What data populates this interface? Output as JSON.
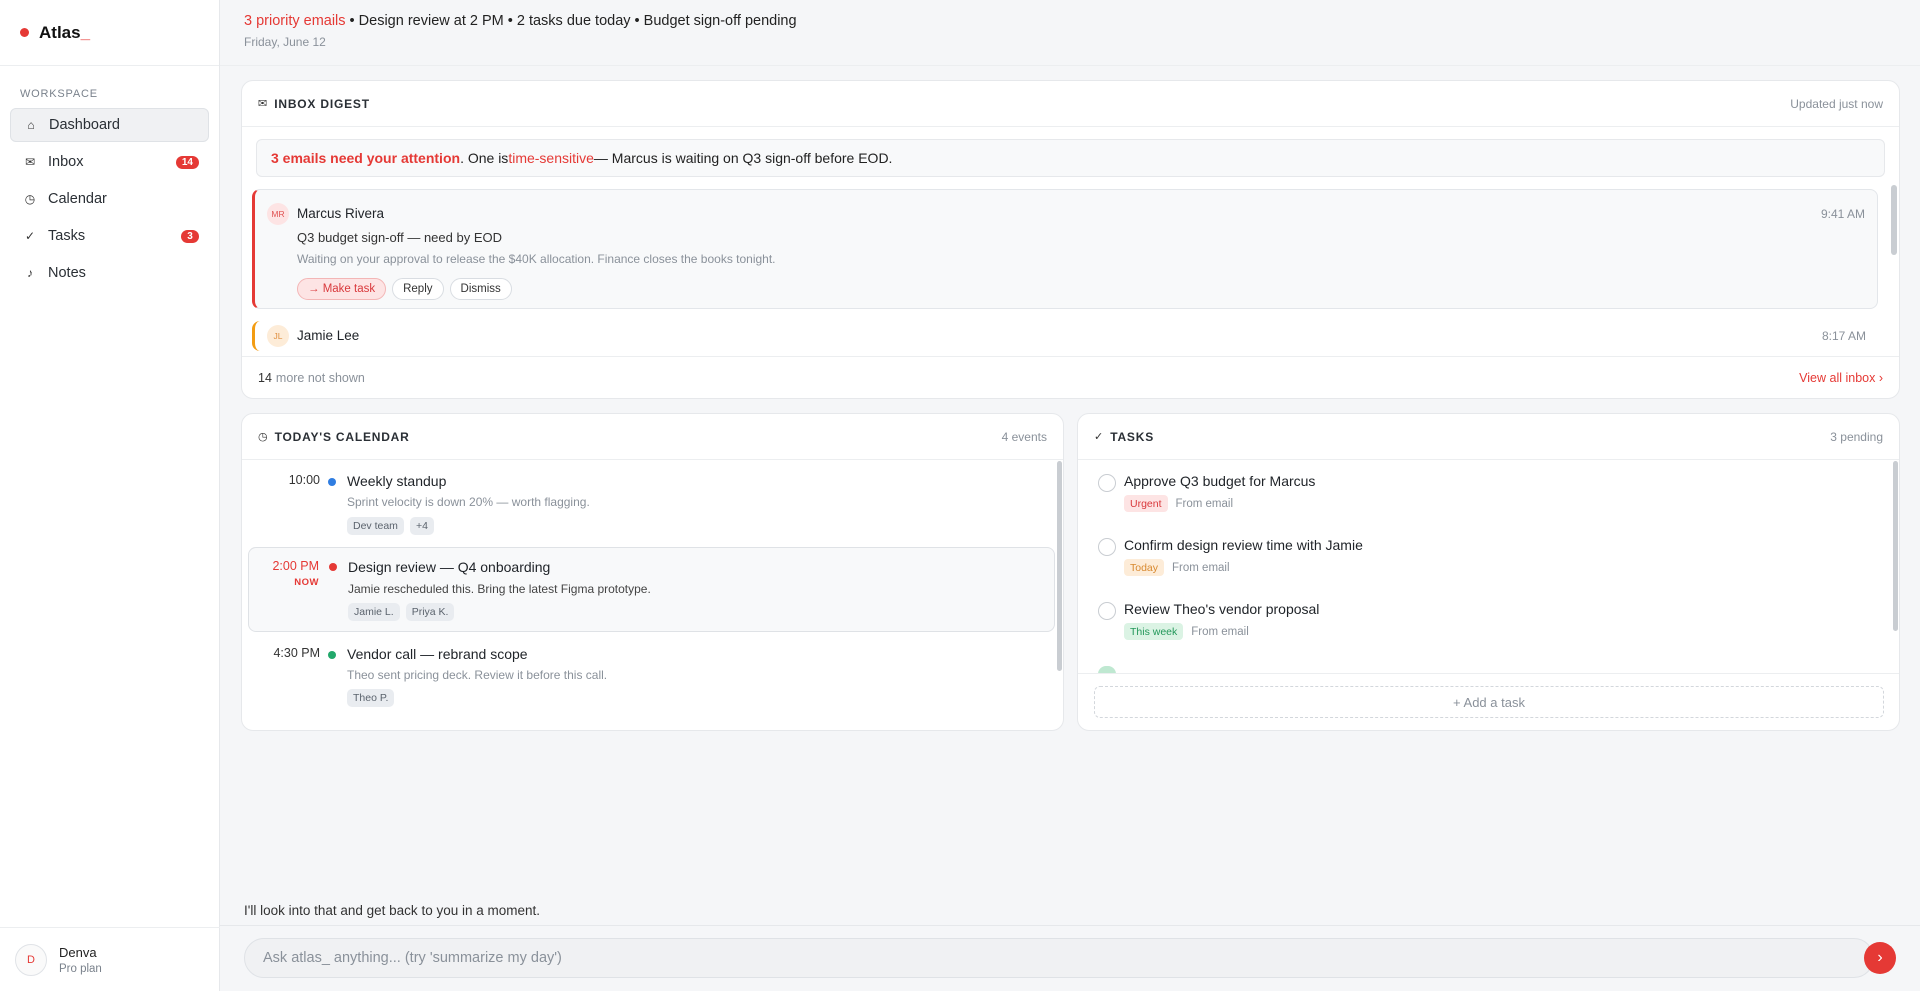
{
  "brand": {
    "name": "Atlas",
    "cursor": "_"
  },
  "sidebar": {
    "section_label": "WORKSPACE",
    "items": [
      {
        "icon": "⌂",
        "label": "Dashboard",
        "badge": ""
      },
      {
        "icon": "✉",
        "label": "Inbox",
        "badge": "14"
      },
      {
        "icon": "◷",
        "label": "Calendar",
        "badge": ""
      },
      {
        "icon": "✓",
        "label": "Tasks",
        "badge": "3"
      },
      {
        "icon": "♪",
        "label": "Notes",
        "badge": ""
      }
    ],
    "user": {
      "initial": "D",
      "name": "Denva",
      "plan": "Pro plan"
    }
  },
  "header": {
    "summary_highlight": "3 priority emails",
    "summary_rest": " • Design review at 2 PM • 2 tasks due today • Budget sign-off pending",
    "date": "Friday, June 12"
  },
  "inbox": {
    "icon": "✉",
    "title": "INBOX DIGEST",
    "updated": "Updated just now",
    "alert": {
      "part1": "3 emails need your attention",
      "part2": ". One is ",
      "part3": "time-sensitive",
      "part4": " — Marcus is waiting on Q3 sign-off before EOD."
    },
    "emails": [
      {
        "initials": "MR",
        "sender": "Marcus Rivera",
        "time": "9:41 AM",
        "subject": "Q3 budget sign-off — need by EOD",
        "preview": "Waiting on your approval to release the $40K allocation. Finance closes the books tonight.",
        "actions": {
          "make_task": "→ Make task",
          "reply": "Reply",
          "dismiss": "Dismiss"
        }
      },
      {
        "initials": "JL",
        "sender": "Jamie Lee",
        "time": "8:17 AM"
      }
    ],
    "more_count": "14",
    "more_text": "more not shown",
    "view_all": "View all inbox ›"
  },
  "calendar": {
    "icon": "◷",
    "title": "TODAY'S CALENDAR",
    "count": "4 events",
    "events": [
      {
        "time": "10:00",
        "title": "Weekly standup",
        "desc": "Sprint velocity is down 20% — worth flagging.",
        "tags": [
          "Dev team",
          "+4"
        ],
        "color": "#2f7de1"
      },
      {
        "time": "2:00 PM",
        "now": "NOW",
        "title": "Design review — Q4 onboarding",
        "desc": "Jamie rescheduled this. Bring the latest Figma prototype.",
        "tags": [
          "Jamie L.",
          "Priya K."
        ],
        "color": "#e53935"
      },
      {
        "time": "4:30 PM",
        "title": "Vendor call — rebrand scope",
        "desc": "Theo sent pricing deck. Review it before this call.",
        "tags": [
          "Theo P."
        ],
        "color": "#22a86b"
      }
    ]
  },
  "tasks": {
    "icon": "✓",
    "title": "TASKS",
    "count": "3 pending",
    "items": [
      {
        "title": "Approve Q3 budget for Marcus",
        "priority": "Urgent",
        "source": "From email"
      },
      {
        "title": "Confirm design review time with Jamie",
        "priority": "Today",
        "source": "From email"
      },
      {
        "title": "Review Theo's vendor proposal",
        "priority": "This week",
        "source": "From email"
      }
    ],
    "add_label": "+ Add a task"
  },
  "chat": {
    "reply": "I'll look into that and get back to you in a moment.",
    "placeholder": "Ask atlas_ anything... (try 'summarize my day')",
    "send_icon": "›"
  },
  "colors": {
    "accent": "#e53935",
    "blue": "#2f7de1",
    "green": "#22a86b",
    "orange": "#f39c12"
  }
}
